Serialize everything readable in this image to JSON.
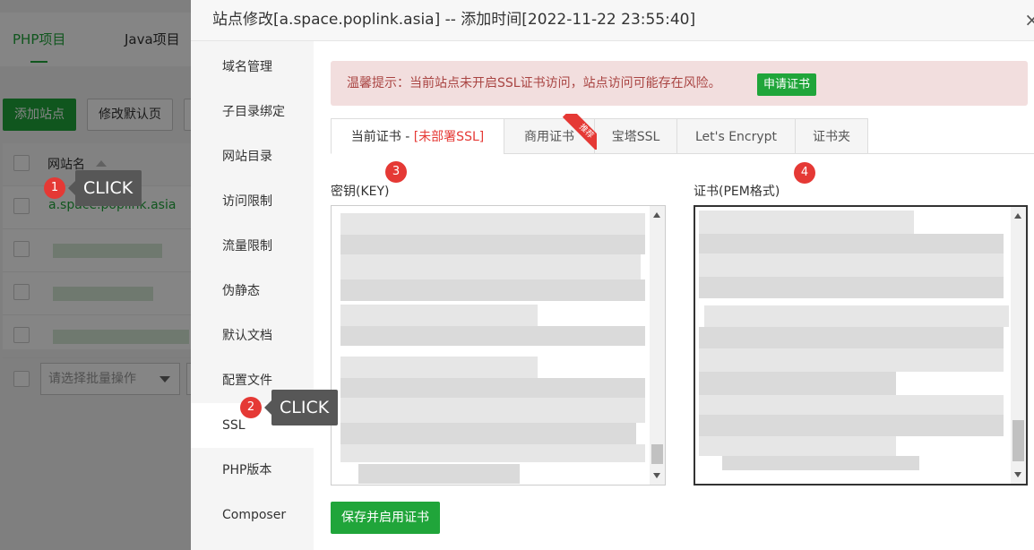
{
  "background": {
    "tabs": [
      "PHP项目",
      "Java项目"
    ],
    "buttons": {
      "add_site": "添加站点",
      "edit_default": "修改默认页"
    },
    "table": {
      "header": "网站名",
      "rows": [
        {
          "name": "a.space.poplink.asia"
        }
      ]
    },
    "batch_select_placeholder": "请选择批量操作"
  },
  "dialog": {
    "title": "站点修改[a.space.poplink.asia] -- 添加时间[2022-11-22 23:55:40]",
    "close_icon": "×",
    "nav": [
      "域名管理",
      "子目录绑定",
      "网站目录",
      "访问限制",
      "流量限制",
      "伪静态",
      "默认文档",
      "配置文件",
      "SSL",
      "PHP版本",
      "Composer"
    ],
    "active_nav": "SSL",
    "alert": {
      "text": "温馨提示：当前站点未开启SSL证书访问，站点访问可能存在风险。",
      "button": "申请证书"
    },
    "cert_tabs": {
      "current_prefix": "当前证书 - ",
      "current_status": "[未部署SSL]",
      "commercial": "商用证书",
      "ribbon": "推荐",
      "baota": "宝塔SSL",
      "letsencrypt": "Let's Encrypt",
      "folder": "证书夹"
    },
    "key_label": "密钥(KEY)",
    "cert_label": "证书(PEM格式)",
    "save_button": "保存并启用证书"
  },
  "annotations": {
    "badges": [
      "1",
      "2",
      "3",
      "4"
    ],
    "click_label": "CLICK"
  },
  "colors": {
    "brand_green": "#20a53a",
    "alert_bg": "#f2dede",
    "alert_text": "#a94442",
    "annotation_red": "#e53935",
    "tooltip_bg": "#575757"
  }
}
